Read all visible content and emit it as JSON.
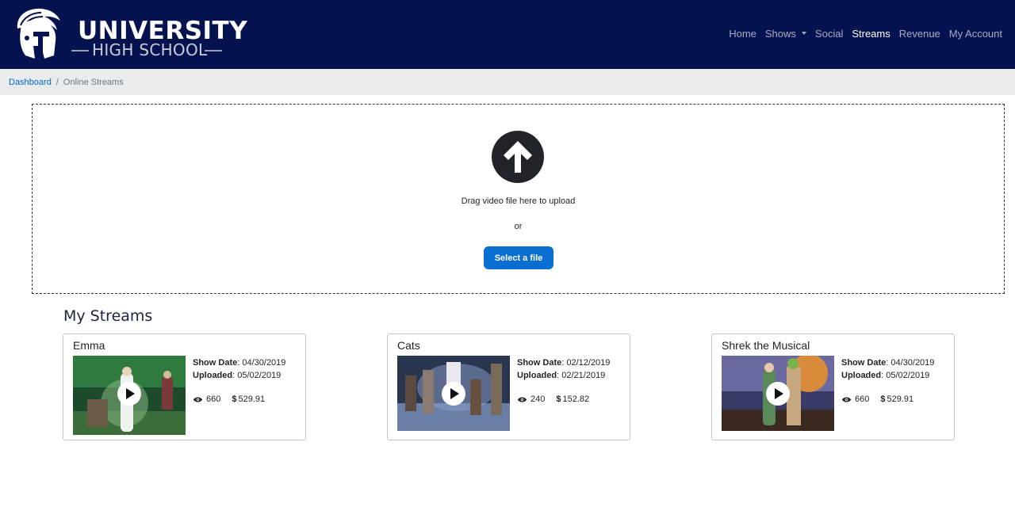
{
  "logo": {
    "line1": "UNIVERSITY",
    "line2": "HIGH SCHOOL"
  },
  "nav": {
    "items": [
      {
        "label": "Home"
      },
      {
        "label": "Shows"
      },
      {
        "label": "Social"
      },
      {
        "label": "Streams"
      },
      {
        "label": "Revenue"
      },
      {
        "label": "My Account"
      }
    ],
    "active": "Streams"
  },
  "breadcrumb": {
    "link": "Dashboard",
    "separator": "/",
    "current": "Online Streams"
  },
  "upload": {
    "drop_text": "Drag video file here to upload",
    "or_text": "or",
    "button_label": "Select a file"
  },
  "streams": {
    "title": "My Streams",
    "show_date_label": "Show Date",
    "uploaded_label": "Uploaded",
    "items": [
      {
        "title": "Emma",
        "show_date": "04/30/2019",
        "uploaded": "05/02/2019",
        "views": "660",
        "revenue": "529.91"
      },
      {
        "title": "Cats",
        "show_date": "02/12/2019",
        "uploaded": "02/21/2019",
        "views": "240",
        "revenue": "152.82"
      },
      {
        "title": "Shrek the Musical",
        "show_date": "04/30/2019",
        "uploaded": "05/02/2019",
        "views": "660",
        "revenue": "529.91"
      }
    ]
  },
  "colors": {
    "navbar": "#04124f",
    "accent": "#0a6fd1",
    "breadcrumb_bg": "#e9ecef"
  }
}
